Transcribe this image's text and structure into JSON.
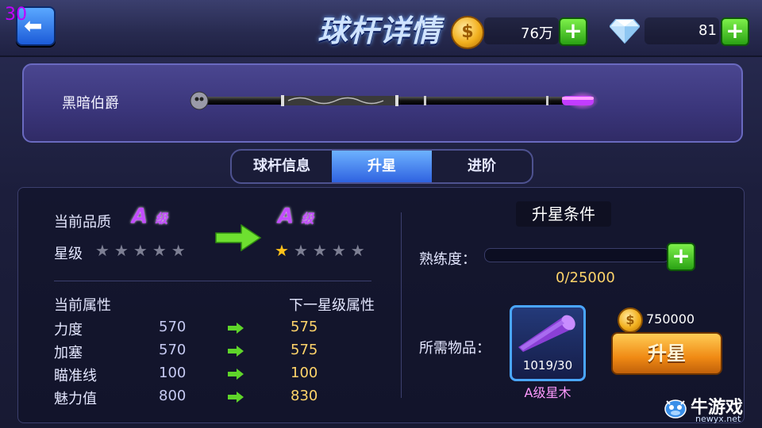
{
  "overlay": {
    "fps": "30"
  },
  "header": {
    "title": "球杆详情",
    "coins": {
      "amount": "76万",
      "icon": "coin-icon"
    },
    "diamonds": {
      "amount": "81",
      "icon": "diamond-icon"
    },
    "plus_label": "+"
  },
  "cue": {
    "name": "黑暗伯爵"
  },
  "tabs": [
    {
      "label": "球杆信息",
      "active": false
    },
    {
      "label": "升星",
      "active": true
    },
    {
      "label": "进阶",
      "active": false
    }
  ],
  "current": {
    "quality_label": "当前品质",
    "quality_grade": "A",
    "quality_suffix": "级",
    "star_label": "星级",
    "stars_lit": 0,
    "stars_total": 5
  },
  "next": {
    "quality_grade": "A",
    "quality_suffix": "级",
    "stars_lit": 1,
    "stars_total": 5
  },
  "attributes": {
    "current_header": "当前属性",
    "next_header": "下一星级属性",
    "rows": [
      {
        "name": "力度",
        "current": "570",
        "next": "575"
      },
      {
        "name": "加塞",
        "current": "570",
        "next": "575"
      },
      {
        "name": "瞄准线",
        "current": "100",
        "next": "100"
      },
      {
        "name": "魅力值",
        "current": "800",
        "next": "830"
      }
    ]
  },
  "conditions": {
    "title": "升星条件",
    "proficiency_label": "熟练度：",
    "proficiency_text": "0/25000",
    "proficiency_fraction": 0,
    "items_label": "所需物品：",
    "item_count": "1019/30",
    "item_name": "A级星木",
    "cost": "750000",
    "upgrade_label": "升星"
  },
  "watermark": {
    "brand": "牛游戏",
    "site": "newyx.net"
  },
  "colors": {
    "accent_green": "#2aa214",
    "grade_purple": "#c34dff",
    "gold": "#ffd46a",
    "tab_active": "#2f62e0"
  }
}
